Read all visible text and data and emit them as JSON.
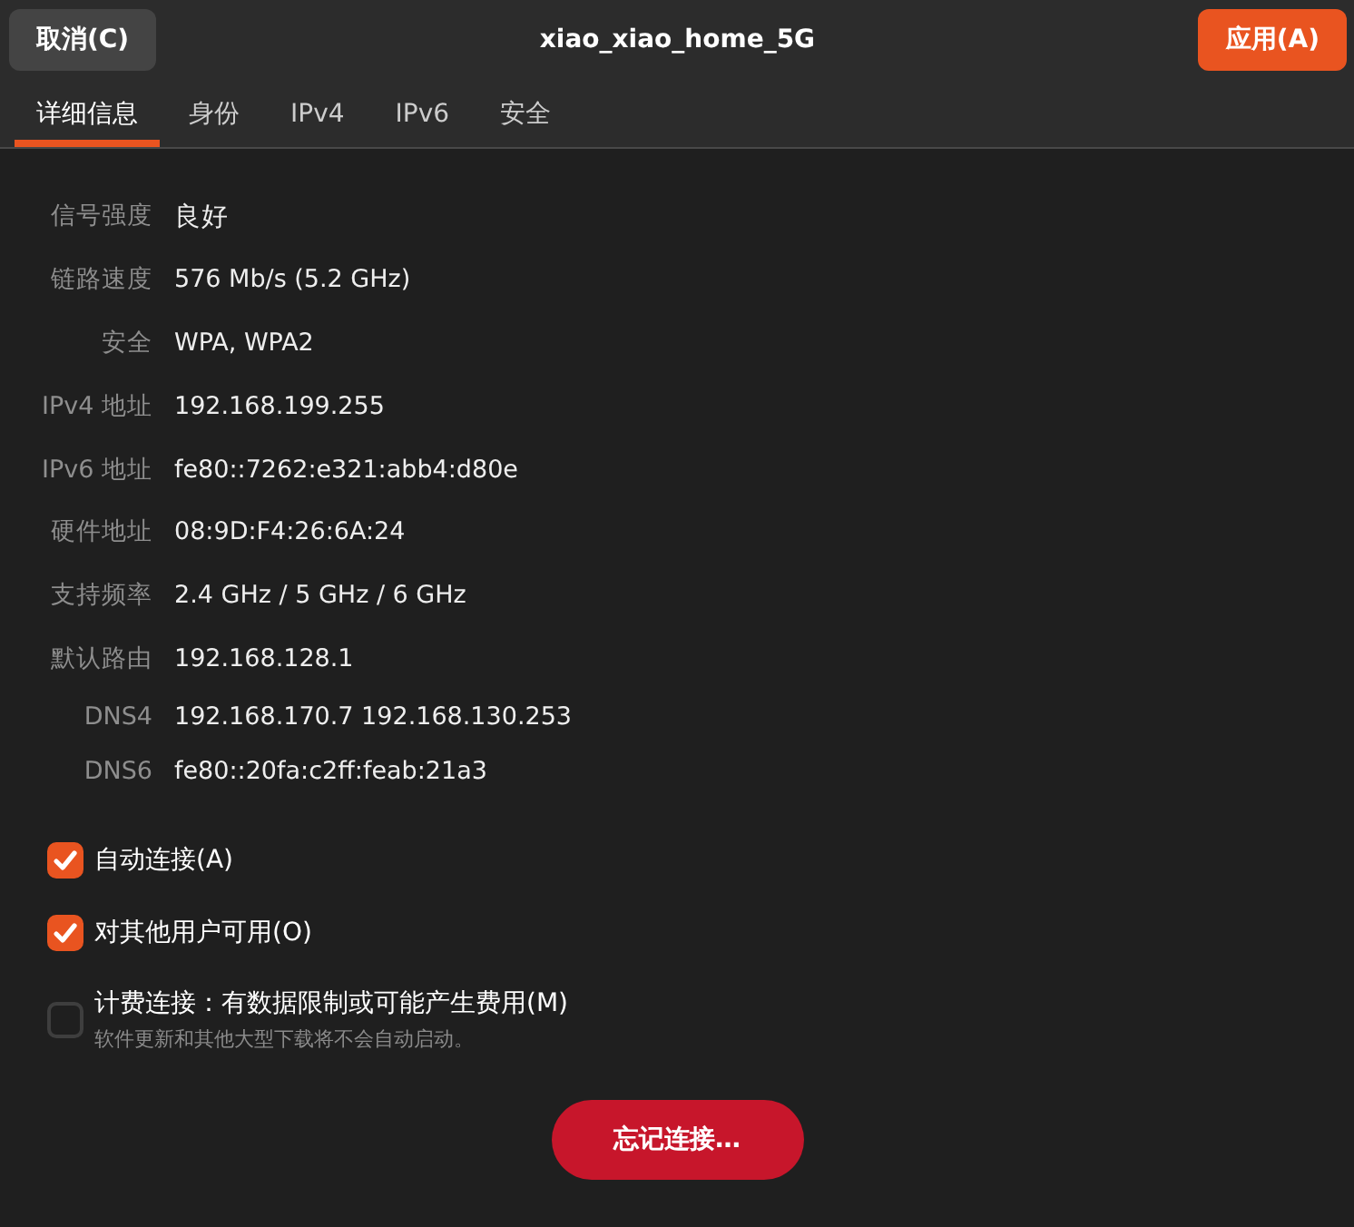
{
  "header": {
    "cancel_button": "取消(C)",
    "title": "xiao_xiao_home_5G",
    "apply_button": "应用(A)"
  },
  "tabs": [
    {
      "label": "详细信息",
      "selected": true
    },
    {
      "label": "身份",
      "selected": false
    },
    {
      "label": "IPv4",
      "selected": false
    },
    {
      "label": "IPv6",
      "selected": false
    },
    {
      "label": "安全",
      "selected": false
    }
  ],
  "details": [
    {
      "label": "信号强度",
      "value": "良好",
      "kind": "main"
    },
    {
      "label": "链路速度",
      "value": "576 Mb/s (5.2 GHz)",
      "kind": "main"
    },
    {
      "label": "安全",
      "value": "WPA, WPA2",
      "kind": "main"
    },
    {
      "label": "IPv4 地址",
      "value": "192.168.199.255",
      "kind": "main"
    },
    {
      "label": "IPv6 地址",
      "value": "fe80::7262:e321:abb4:d80e",
      "kind": "main"
    },
    {
      "label": "硬件地址",
      "value": "08:9D:F4:26:6A:24",
      "kind": "main"
    },
    {
      "label": "支持频率",
      "value": "2.4 GHz / 5 GHz / 6 GHz",
      "kind": "main"
    },
    {
      "label": "默认路由",
      "value": "192.168.128.1",
      "kind": "main"
    },
    {
      "label": "DNS4",
      "value": "192.168.170.7 192.168.130.253",
      "kind": "dns"
    },
    {
      "label": "DNS6",
      "value": "fe80::20fa:c2ff:feab:21a3",
      "kind": "dns"
    }
  ],
  "options": [
    {
      "label": "自动连接(A)",
      "checked": true
    },
    {
      "label": "对其他用户可用(O)",
      "checked": true
    },
    {
      "label": "计费连接：有数据限制或可能产生费用(M)",
      "hint": "软件更新和其他大型下载将不会自动启动。",
      "checked": false
    }
  ],
  "forget_button": "忘记连接…"
}
